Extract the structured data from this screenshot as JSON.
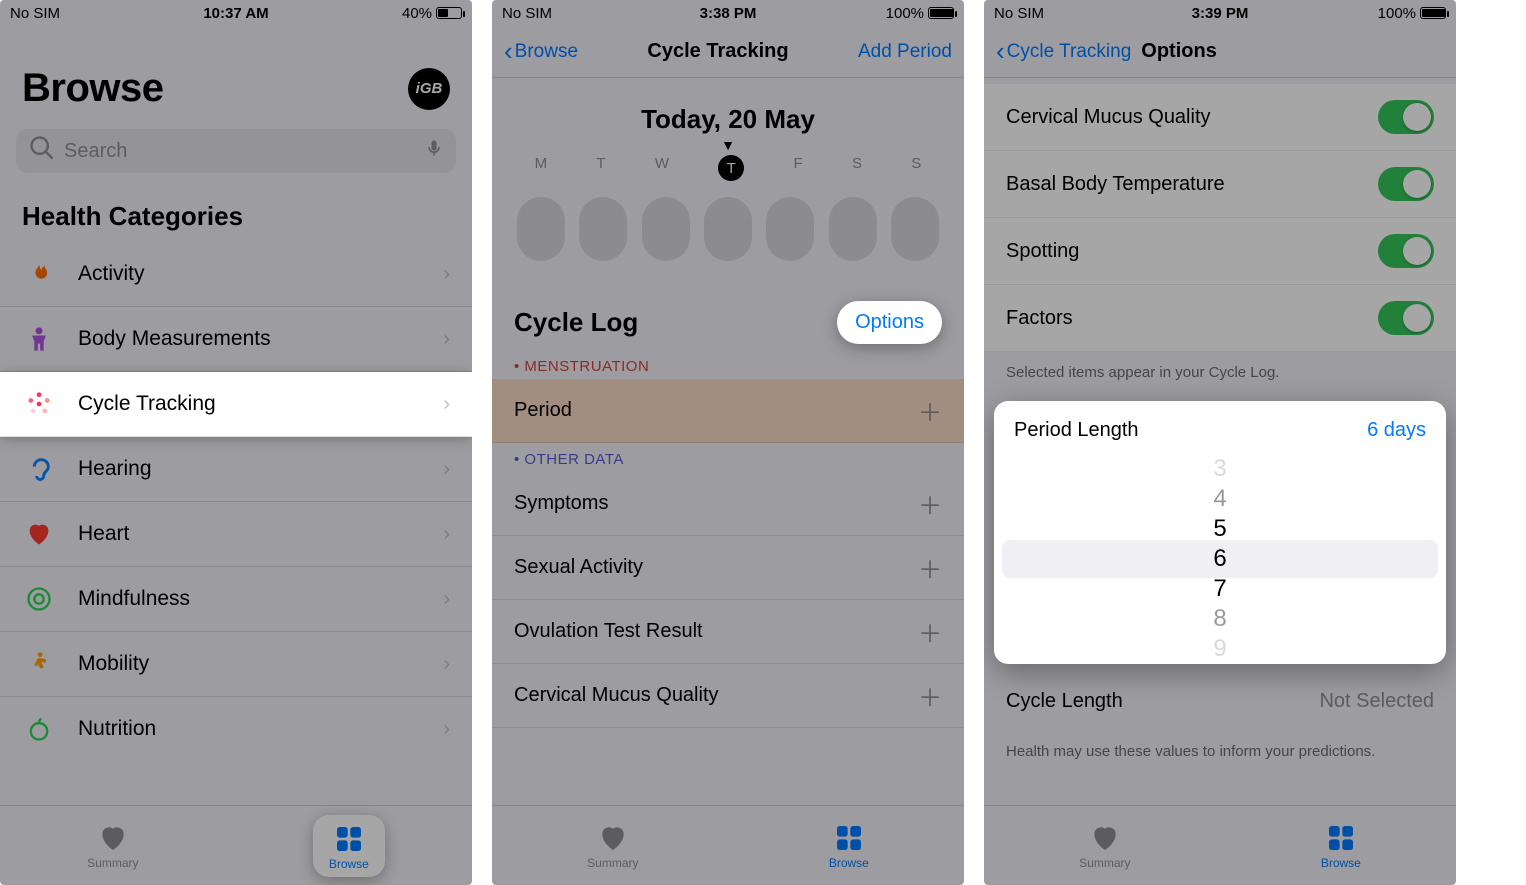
{
  "panel1": {
    "status": {
      "carrier": "No SIM",
      "time": "10:37 AM",
      "battery_text": "40%",
      "battery_pct": 40
    },
    "title": "Browse",
    "avatar": "iGB",
    "search_placeholder": "Search",
    "section": "Health Categories",
    "categories": [
      {
        "label": "Activity",
        "icon": "flame-icon",
        "color": "#ff3b30"
      },
      {
        "label": "Body Measurements",
        "icon": "person-icon",
        "color": "#af52de"
      },
      {
        "label": "Cycle Tracking",
        "icon": "cycle-icon",
        "color": "#ff2d55"
      },
      {
        "label": "Hearing",
        "icon": "ear-icon",
        "color": "#0a84ff"
      },
      {
        "label": "Heart",
        "icon": "heart-icon",
        "color": "#ff3b30"
      },
      {
        "label": "Mindfulness",
        "icon": "mind-icon",
        "color": "#30d158"
      },
      {
        "label": "Mobility",
        "icon": "walk-icon",
        "color": "#ff9f0a"
      },
      {
        "label": "Nutrition",
        "icon": "apple-icon",
        "color": "#30d158"
      }
    ],
    "tabs": {
      "summary": "Summary",
      "browse": "Browse"
    }
  },
  "panel2": {
    "status": {
      "carrier": "No SIM",
      "time": "3:38 PM",
      "battery_text": "100%",
      "battery_pct": 100
    },
    "nav": {
      "back": "Browse",
      "title": "Cycle Tracking",
      "action": "Add Period"
    },
    "date": "Today, 20 May",
    "weekdays": [
      "M",
      "T",
      "W",
      "T",
      "F",
      "S",
      "S"
    ],
    "today_index": 3,
    "log_title": "Cycle Log",
    "options_label": "Options",
    "section_menstruation": "MENSTRUATION",
    "period_row": "Period",
    "section_other": "OTHER DATA",
    "other_rows": [
      "Symptoms",
      "Sexual Activity",
      "Ovulation Test Result",
      "Cervical Mucus Quality"
    ],
    "tabs": {
      "summary": "Summary",
      "browse": "Browse"
    }
  },
  "panel3": {
    "status": {
      "carrier": "No SIM",
      "time": "3:39 PM",
      "battery_text": "100%",
      "battery_pct": 100
    },
    "nav": {
      "back": "Cycle Tracking",
      "title": "Options"
    },
    "toggles": [
      "Cervical Mucus Quality",
      "Basal Body Temperature",
      "Spotting",
      "Factors"
    ],
    "toggle_note": "Selected items appear in your Cycle Log.",
    "picker": {
      "label": "Period Length",
      "value_text": "6 days",
      "options": [
        "3",
        "4",
        "5",
        "6",
        "7",
        "8",
        "9"
      ],
      "selected_index": 3
    },
    "cycle_length": {
      "label": "Cycle Length",
      "value": "Not Selected"
    },
    "footer": "Health may use these values to inform your predictions.",
    "tabs": {
      "summary": "Summary",
      "browse": "Browse"
    }
  }
}
